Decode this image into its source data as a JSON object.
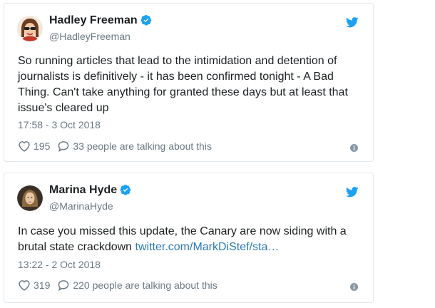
{
  "tweets": [
    {
      "name": "Hadley Freeman",
      "handle": "@HadleyFreeman",
      "text": "So running articles that lead to the intimidation and detention of journalists is definitively - it has been confirmed tonight - A Bad Thing. Can't take anything for granted these days but at least that issue's cleared up",
      "link": "",
      "timestamp": "17:58 - 3 Oct 2018",
      "likes": "195",
      "talking": "33 people are talking about this"
    },
    {
      "name": "Marina Hyde",
      "handle": "@MarinaHyde",
      "text": "In case you missed this update, the Canary are now siding with a brutal state crackdown ",
      "link": "twitter.com/MarkDiStef/sta…",
      "timestamp": "13:22 - 2 Oct 2018",
      "likes": "319",
      "talking": "220 people are talking about this"
    }
  ],
  "colors": {
    "verified": "#1da1f2",
    "bird": "#1da1f2",
    "link": "#2b7bb9",
    "meta": "#697882",
    "border": "#e1e8ed"
  },
  "icons": [
    "verified-badge-icon",
    "twitter-bird-icon",
    "heart-icon",
    "comment-bubble-icon",
    "info-icon"
  ]
}
